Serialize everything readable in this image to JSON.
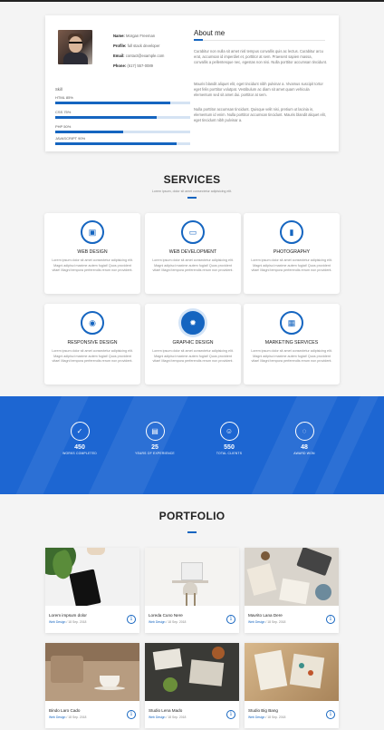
{
  "profile": {
    "name_label": "Name:",
    "name": "Morgan Freeman",
    "profile_label": "Profile:",
    "profile": "full stack developer",
    "email_label": "Email:",
    "email": "contact@example.com",
    "phone_label": "Phone:",
    "phone": "(617) 557-0089",
    "skills_title": "Skill",
    "skills": [
      {
        "label": "HTML 85%",
        "value": 0.85
      },
      {
        "label": "CSS 75%",
        "value": 0.75
      },
      {
        "label": "PHP 50%",
        "value": 0.5
      },
      {
        "label": "JAVASCRIPT 90%",
        "value": 0.9
      }
    ],
    "about_title": "About me",
    "about_paragraphs": [
      "Curabitur non nulla sit amet nisl tempus convallis quis ac lectus. Curabitur arcu erat, accumsan id imperdiet et, porttitor at sem. Praesent sapien massa, convallis a pellentesque nec, egestas non nisi. Nulla porttitor accumsan tincidunt.",
      "Mauris blandit aliquet elit, eget tincidunt nibh pulvinar a. Vivamus suscipit tortor eget felis porttitor volutpat. Vestibulum ac diam sit amet quam vehicula elementum sed sit amet dui. porttitor at sem.",
      "Nulla porttitor accumsan tincidunt. Quisque velit nisi, pretium ut lacinia in, elementum id enim. Nulla porttitor accumsan tincidunt. Mauris blandit aliquet elit, eget tincidunt nibh pulvinar a."
    ]
  },
  "services": {
    "title": "SERVICES",
    "subtitle": "Lorem ipsum, dolor sit amet consectetur adipisicing elit.",
    "items": [
      {
        "title": "WEB DESIGN",
        "icon": "briefcase-icon",
        "glyph": "▣",
        "desc": "Lorem ipsum dolor sit amet consectetur adipisicing elit. Magni adipisci maxime autem fugiat! Quos provident vitae! Magni tempora perferendis rerum non provident."
      },
      {
        "title": "WEB DEVELOPMENT",
        "icon": "card-icon",
        "glyph": "▭",
        "desc": "Lorem ipsum dolor sit amet consectetur adipisicing elit. Magni adipisci maxime autem fugiat! Quos provident vitae! Magni tempora perferendis rerum non provident."
      },
      {
        "title": "PHOTOGRAPHY",
        "icon": "bar-chart-icon",
        "glyph": "▮",
        "desc": "Lorem ipsum dolor sit amet consectetur adipisicing elit. Magni adipisci maxime autem fugiat! Quos provident vitae! Magni tempora perferendis rerum non provident."
      },
      {
        "title": "RESPONSIVE DESIGN",
        "icon": "binoculars-icon",
        "glyph": "◉",
        "desc": "Lorem ipsum dolor sit amet consectetur adipisicing elit. Magni adipisci maxime autem fugiat! Quos provident vitae! Magni tempora perferendis rerum non provident."
      },
      {
        "title": "GRAPHIC DESIGN",
        "icon": "sun-icon",
        "glyph": "✹",
        "desc": "Lorem ipsum dolor sit amet consectetur adipisicing elit. Magni adipisci maxime autem fugiat! Quos provident vitae! Magni tempora perferendis rerum non provident."
      },
      {
        "title": "MARKETING SERVICES",
        "icon": "calendar-icon",
        "glyph": "▦",
        "desc": "Lorem ipsum dolor sit amet consectetur adipisicing elit. Magni adipisci maxime autem fugiat! Quos provident vitae! Magni tempora perferendis rerum non provident."
      }
    ]
  },
  "stats": [
    {
      "number": "450",
      "label": "WORKS COMPLETED",
      "icon": "check-icon",
      "glyph": "✓"
    },
    {
      "number": "25",
      "label": "YEARS OF EXPERIENCE",
      "icon": "journal-icon",
      "glyph": "▤"
    },
    {
      "number": "550",
      "label": "TOTAL CLIENTS",
      "icon": "people-icon",
      "glyph": "☺"
    },
    {
      "number": "48",
      "label": "AWARD WON",
      "icon": "lightbulb-icon",
      "glyph": "◌"
    }
  ],
  "portfolio": {
    "title": "PORTFOLIO",
    "items": [
      {
        "title": "Lorem impsum dolor",
        "category": "Web Design",
        "date": "18 Sep. 2018"
      },
      {
        "title": "Loreda Cuno Nere",
        "category": "Web Design",
        "date": "18 Sep. 2018"
      },
      {
        "title": "Mavrito Lana Dere",
        "category": "Web Design",
        "date": "18 Sep. 2018"
      },
      {
        "title": "Bindo Laro Cado",
        "category": "Web Design",
        "date": "18 Sep. 2018"
      },
      {
        "title": "Studio Lena Mado",
        "category": "Web Design",
        "date": "18 Sep. 2018"
      },
      {
        "title": "Studio Big Bang",
        "category": "Web Design",
        "date": "18 Sep. 2018"
      }
    ]
  },
  "colors": {
    "accent": "#1565c0",
    "band": "#1d66d2"
  }
}
